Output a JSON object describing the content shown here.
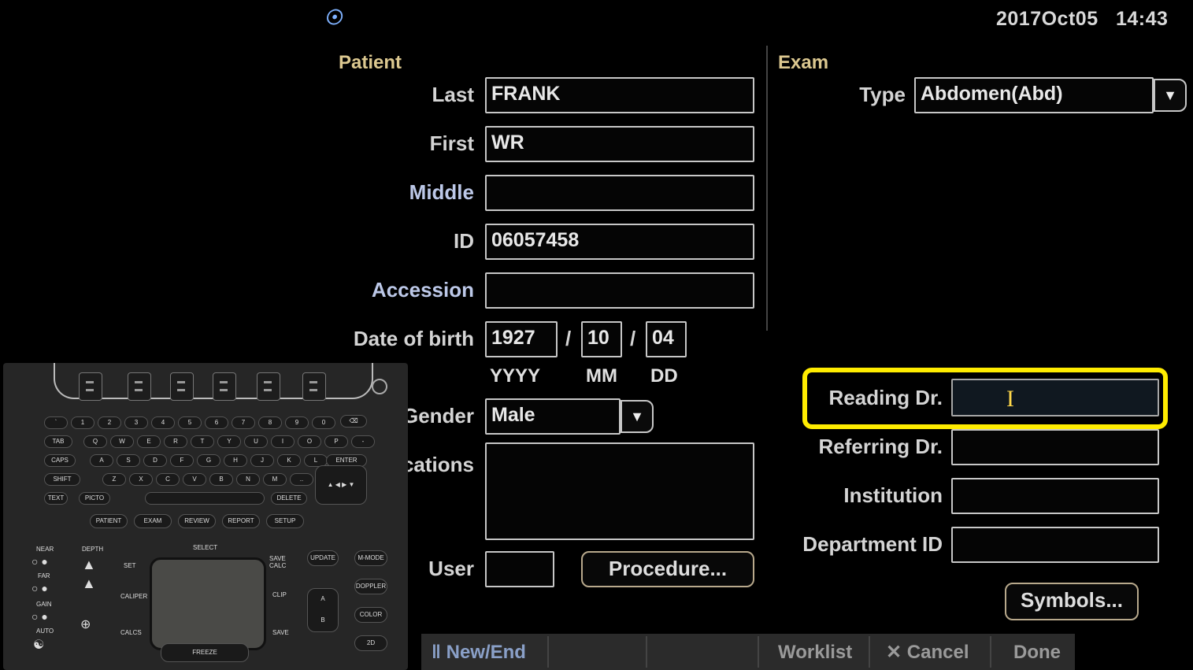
{
  "header": {
    "date": "2017Oct05",
    "time": "14:43"
  },
  "patient": {
    "section_title": "Patient",
    "last_label": "Last",
    "last_value": "FRANK",
    "first_label": "First",
    "first_value": "WR",
    "middle_label": "Middle",
    "middle_value": "",
    "id_label": "ID",
    "id_value": "06057458",
    "accession_label": "Accession",
    "accession_value": "",
    "dob_label": "Date of birth",
    "dob_year": "1927",
    "dob_month": "10",
    "dob_day": "04",
    "dob_sep": "/",
    "yyyy": "YYYY",
    "mm": "MM",
    "dd": "DD",
    "gender_label": "Gender",
    "gender_value": "Male",
    "indications_label": "Indications",
    "user_label": "User",
    "user_value": "",
    "procedure_button": "Procedure..."
  },
  "exam": {
    "section_title": "Exam",
    "type_label": "Type",
    "type_value": "Abdomen(Abd)",
    "reading_label": "Reading Dr.",
    "reading_value": "",
    "referring_label": "Referring Dr.",
    "referring_value": "",
    "institution_label": "Institution",
    "institution_value": "",
    "department_label": "Department ID",
    "department_value": "",
    "symbols_button": "Symbols..."
  },
  "bottom_bar": {
    "new_end": "New/End",
    "worklist": "Worklist",
    "cancel": "Cancel",
    "done": "Done"
  },
  "keyboard": {
    "row1": [
      "`",
      "1",
      "2",
      "3",
      "4",
      "5",
      "6",
      "7",
      "8",
      "9",
      "0"
    ],
    "row2": [
      "TAB",
      "Q",
      "W",
      "E",
      "R",
      "T",
      "Y",
      "U",
      "I",
      "O",
      "P",
      "-"
    ],
    "row3": [
      "CAPS",
      "A",
      "S",
      "D",
      "F",
      "G",
      "H",
      "J",
      "K",
      "L",
      "ENTER"
    ],
    "row4": [
      "SHIFT",
      "Z",
      "X",
      "C",
      "V",
      "B",
      "N",
      "M",
      ".."
    ],
    "row5": [
      "TEXT",
      "PICTO",
      "DELETE"
    ],
    "mode_keys": [
      "PATIENT",
      "EXAM",
      "REVIEW",
      "REPORT",
      "SETUP"
    ],
    "select": "SELECT",
    "set": "SET",
    "save_calc": "SAVE CALC",
    "update": "UPDATE",
    "m_mode": "M-MODE",
    "doppler": "DOPPLER",
    "color": "COLOR",
    "two_d": "2D",
    "caliper": "CALIPER",
    "calcs": "CALCS",
    "clip": "CLIP",
    "save": "SAVE",
    "freeze": "FREEZE",
    "a": "A",
    "b": "B",
    "near": "NEAR",
    "far": "FAR",
    "gain": "GAIN",
    "auto": "AUTO",
    "depth": "DEPTH"
  }
}
